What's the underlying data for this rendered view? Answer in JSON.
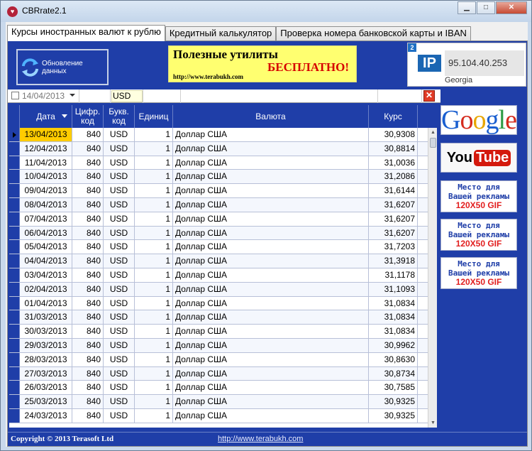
{
  "window": {
    "title": "CBRrate2.1",
    "app_icon_glyph": "♥",
    "minimize_glyph": "▁",
    "maximize_glyph": "□",
    "close_glyph": "✕"
  },
  "tabs": [
    {
      "label": "Курсы иностранных валют к рублю",
      "active": true
    },
    {
      "label": "Кредитный калькулятор",
      "active": false
    },
    {
      "label": "Проверка номера банковской карты и IBAN",
      "active": false
    }
  ],
  "toolbar": {
    "update_label": "Обновление данных"
  },
  "banner": {
    "line1": "Полезные утилиты",
    "line2": "БЕСПЛАТНО!",
    "url": "http://www.terabukh.com"
  },
  "ip_widget": {
    "badge": "2",
    "logo": "IP",
    "address": "95.104.40.253",
    "country": "Georgia"
  },
  "filter": {
    "date": "14/04/2013",
    "code": "USD",
    "clear_glyph": "✕"
  },
  "grid": {
    "columns": [
      "Дата",
      "Цифр. код",
      "Букв. код",
      "Единиц",
      "Валюта",
      "Курс"
    ],
    "rows": [
      {
        "date": "13/04/2013",
        "num": "840",
        "code": "USD",
        "unit": "1",
        "name": "Доллар США",
        "rate": "30,9308"
      },
      {
        "date": "12/04/2013",
        "num": "840",
        "code": "USD",
        "unit": "1",
        "name": "Доллар США",
        "rate": "30,8814"
      },
      {
        "date": "11/04/2013",
        "num": "840",
        "code": "USD",
        "unit": "1",
        "name": "Доллар США",
        "rate": "31,0036"
      },
      {
        "date": "10/04/2013",
        "num": "840",
        "code": "USD",
        "unit": "1",
        "name": "Доллар США",
        "rate": "31,2086"
      },
      {
        "date": "09/04/2013",
        "num": "840",
        "code": "USD",
        "unit": "1",
        "name": "Доллар США",
        "rate": "31,6144"
      },
      {
        "date": "08/04/2013",
        "num": "840",
        "code": "USD",
        "unit": "1",
        "name": "Доллар США",
        "rate": "31,6207"
      },
      {
        "date": "07/04/2013",
        "num": "840",
        "code": "USD",
        "unit": "1",
        "name": "Доллар США",
        "rate": "31,6207"
      },
      {
        "date": "06/04/2013",
        "num": "840",
        "code": "USD",
        "unit": "1",
        "name": "Доллар США",
        "rate": "31,6207"
      },
      {
        "date": "05/04/2013",
        "num": "840",
        "code": "USD",
        "unit": "1",
        "name": "Доллар США",
        "rate": "31,7203"
      },
      {
        "date": "04/04/2013",
        "num": "840",
        "code": "USD",
        "unit": "1",
        "name": "Доллар США",
        "rate": "31,3918"
      },
      {
        "date": "03/04/2013",
        "num": "840",
        "code": "USD",
        "unit": "1",
        "name": "Доллар США",
        "rate": "31,1178"
      },
      {
        "date": "02/04/2013",
        "num": "840",
        "code": "USD",
        "unit": "1",
        "name": "Доллар США",
        "rate": "31,1093"
      },
      {
        "date": "01/04/2013",
        "num": "840",
        "code": "USD",
        "unit": "1",
        "name": "Доллар США",
        "rate": "31,0834"
      },
      {
        "date": "31/03/2013",
        "num": "840",
        "code": "USD",
        "unit": "1",
        "name": "Доллар США",
        "rate": "31,0834"
      },
      {
        "date": "30/03/2013",
        "num": "840",
        "code": "USD",
        "unit": "1",
        "name": "Доллар США",
        "rate": "31,0834"
      },
      {
        "date": "29/03/2013",
        "num": "840",
        "code": "USD",
        "unit": "1",
        "name": "Доллар США",
        "rate": "30,9962"
      },
      {
        "date": "28/03/2013",
        "num": "840",
        "code": "USD",
        "unit": "1",
        "name": "Доллар США",
        "rate": "30,8630"
      },
      {
        "date": "27/03/2013",
        "num": "840",
        "code": "USD",
        "unit": "1",
        "name": "Доллар США",
        "rate": "30,8734"
      },
      {
        "date": "26/03/2013",
        "num": "840",
        "code": "USD",
        "unit": "1",
        "name": "Доллар США",
        "rate": "30,7585"
      },
      {
        "date": "25/03/2013",
        "num": "840",
        "code": "USD",
        "unit": "1",
        "name": "Доллар США",
        "rate": "30,9325"
      },
      {
        "date": "24/03/2013",
        "num": "840",
        "code": "USD",
        "unit": "1",
        "name": "Доллар США",
        "rate": "30,9325"
      }
    ],
    "selected_index": 0,
    "scroll_up_glyph": "▲",
    "scroll_down_glyph": "▼"
  },
  "ads": {
    "google": [
      "G",
      "o",
      "o",
      "g",
      "l",
      "e"
    ],
    "youtube_you": "You",
    "youtube_tube": "Tube",
    "placeholder_line1": "Место для",
    "placeholder_line2": "Вашей рекламы",
    "placeholder_size": "120X50 GIF"
  },
  "status": {
    "copyright": "Copyright © 2013 Terasoft Ltd",
    "link": "http://www.terabukh.com"
  },
  "colors": {
    "panel_blue": "#1f3ea8",
    "selected_cell": "#ffcc00",
    "banner_bg": "#ffff70",
    "banner_red": "#d60000"
  }
}
